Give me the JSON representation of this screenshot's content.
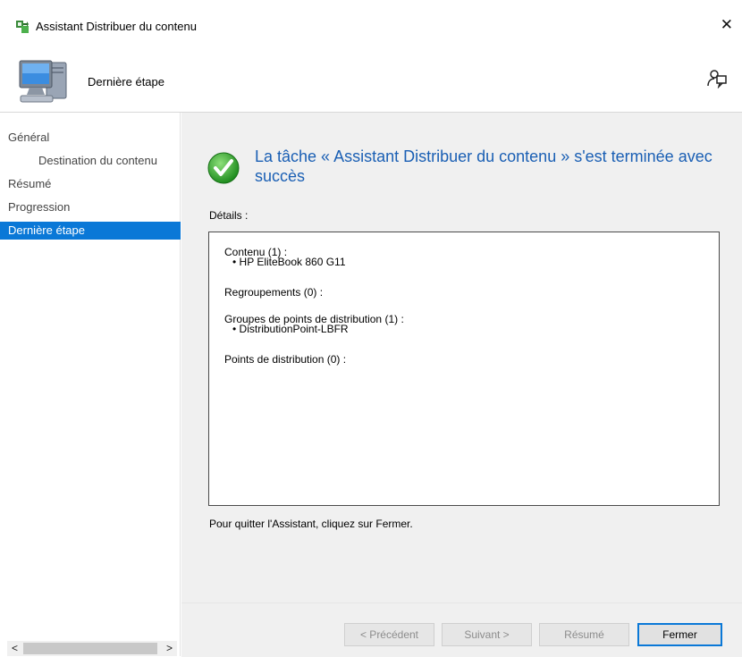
{
  "window": {
    "title": "Assistant Distribuer du contenu",
    "close_glyph": "✕",
    "icon": "package-distribute-icon"
  },
  "header": {
    "step_title": "Dernière étape",
    "icon": "computer-icon",
    "help_icon": "help-person-icon"
  },
  "sidebar": {
    "items": [
      {
        "label": "Général",
        "level": 0,
        "active": false
      },
      {
        "label": "Destination du contenu",
        "level": 1,
        "active": false
      },
      {
        "label": "Résumé",
        "level": 0,
        "active": false
      },
      {
        "label": "Progression",
        "level": 0,
        "active": false
      },
      {
        "label": "Dernière étape",
        "level": 0,
        "active": true
      }
    ],
    "scroll_left": "<",
    "scroll_right": ">"
  },
  "main": {
    "headline": "La tâche « Assistant Distribuer du contenu » s'est terminée avec succès",
    "success_icon": "green-check-icon",
    "details_label": "Détails :",
    "details": {
      "content_title": "Contenu (1) :",
      "content_item": "• HP EliteBook 860 G11",
      "groupings_title": "Regroupements (0) :",
      "dp_groups_title": "Groupes de points de distribution (1) :",
      "dp_groups_item": "• DistributionPoint-LBFR",
      "dps_title": "Points de distribution (0) :"
    },
    "footer_hint": "Pour quitter l'Assistant, cliquez sur Fermer."
  },
  "buttons": {
    "previous": "< Précédent",
    "next": "Suivant >",
    "summary": "Résumé",
    "close": "Fermer"
  },
  "colors": {
    "accent": "#0a78d7",
    "headline": "#1a5fb4",
    "content_bg": "#f0f0f0"
  }
}
